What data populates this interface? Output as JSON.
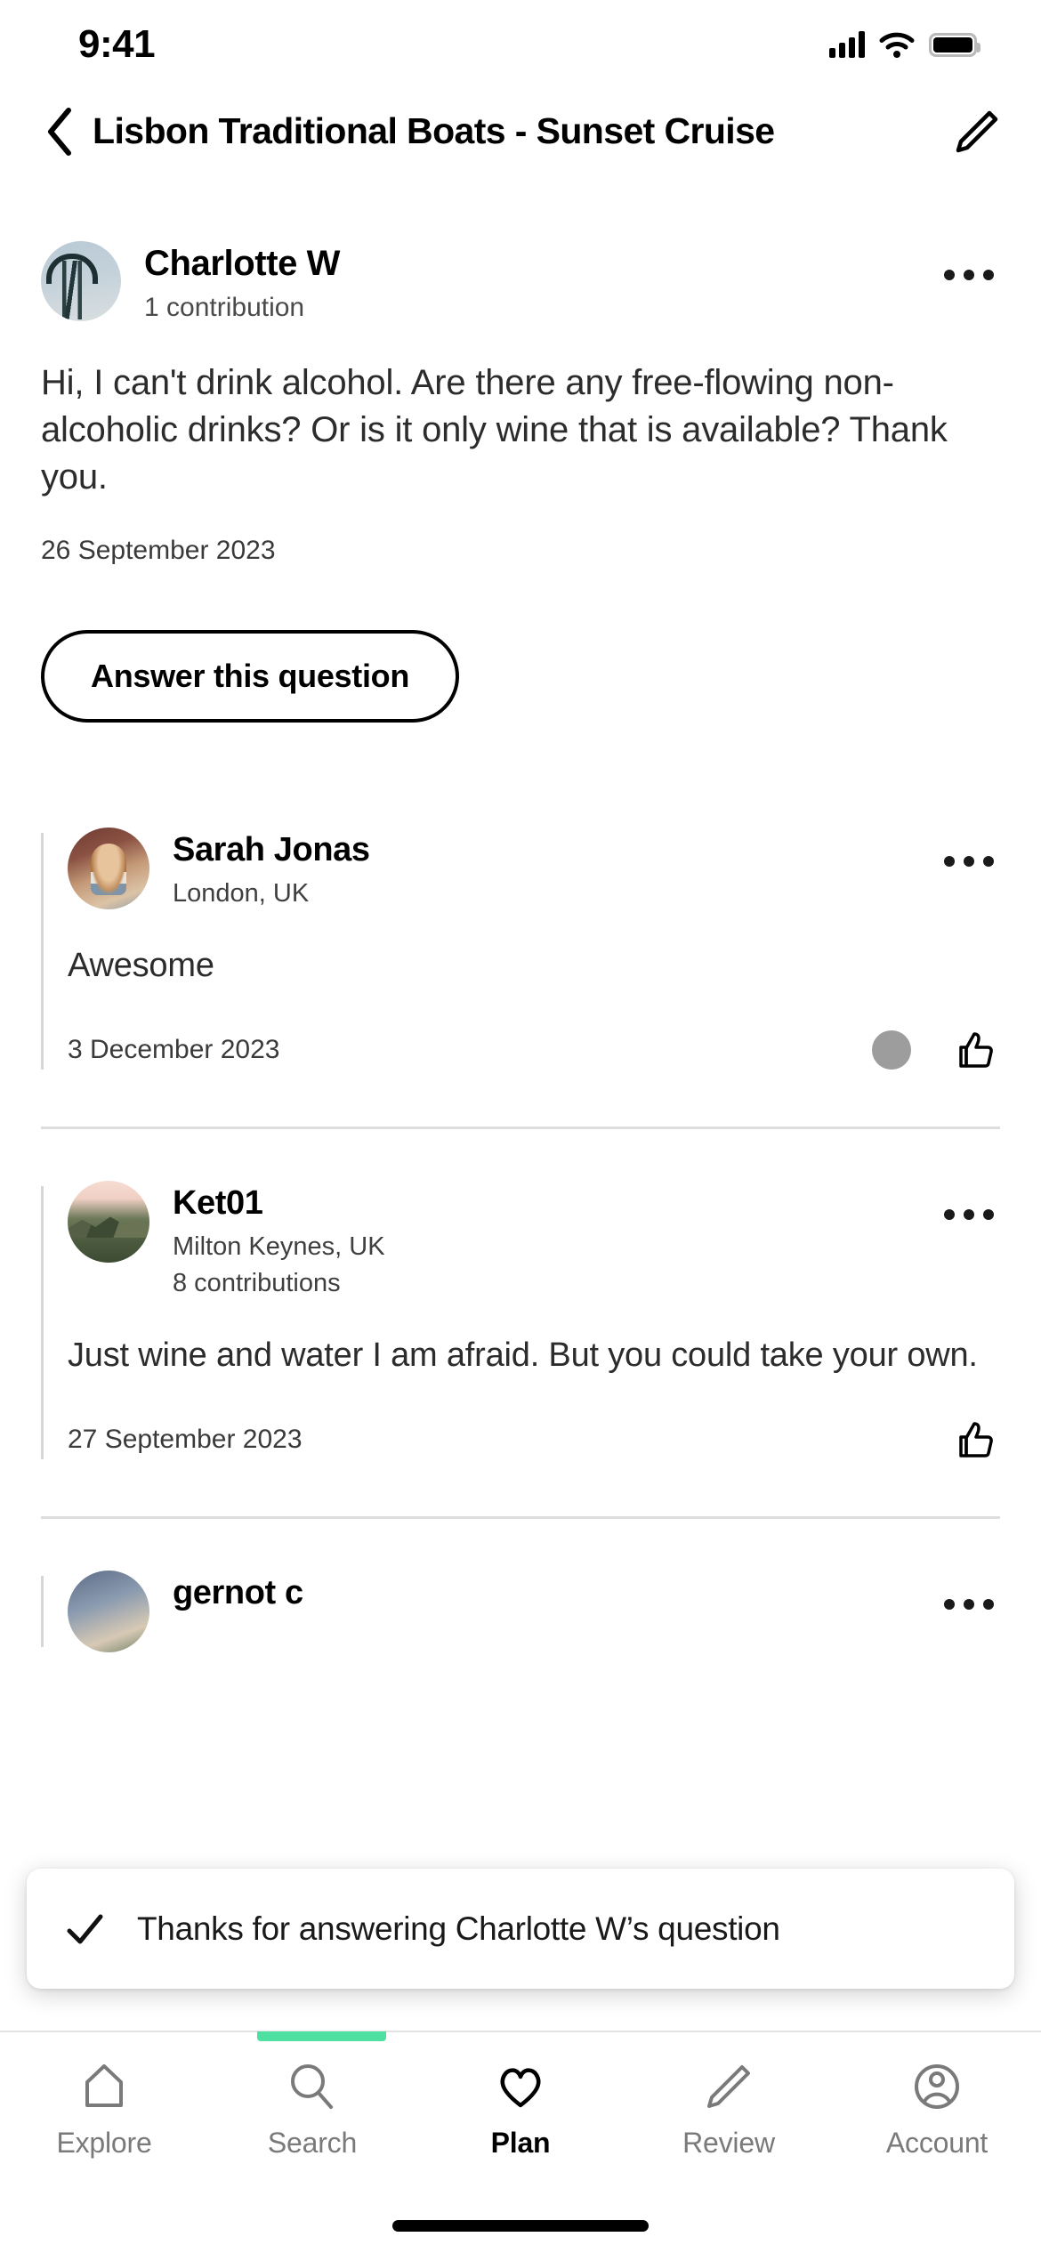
{
  "status_bar": {
    "time": "9:41",
    "signal_icon": "cellular-bars-icon",
    "wifi_icon": "wifi-icon",
    "battery_icon": "battery-full-icon"
  },
  "header": {
    "back_icon": "chevron-left-icon",
    "title": "Lisbon Traditional Boats - Sunset Cruise",
    "edit_icon": "pencil-icon"
  },
  "question": {
    "author": "Charlotte W",
    "contributions": "1 contribution",
    "avatar_icon": "roller-coaster-avatar",
    "more_icon": "more-options-icon",
    "text": "Hi, I can't drink alcohol. Are there any free-flowing non-alcoholic drinks? Or is it only wine that is available? Thank you.",
    "date": "26 September 2023",
    "answer_button": "Answer this question"
  },
  "replies": [
    {
      "author": "Sarah Jonas",
      "location": "London, UK",
      "contributions": "",
      "avatar_icon": "sarah-avatar",
      "more_icon": "more-options-icon",
      "text": "Awesome",
      "date": "3 December 2023",
      "like_icon": "thumbs-up-icon",
      "has_grey_dot": true
    },
    {
      "author": "Ket01",
      "location": "Milton Keynes, UK",
      "contributions": "8 contributions",
      "avatar_icon": "ket01-avatar",
      "more_icon": "more-options-icon",
      "text": "Just wine and water I am afraid. But you could take your own.",
      "date": "27 September 2023",
      "like_icon": "thumbs-up-icon",
      "has_grey_dot": false
    },
    {
      "author": "gernot c",
      "location": "",
      "contributions": "",
      "avatar_icon": "gernot-avatar",
      "more_icon": "more-options-icon",
      "text": "",
      "date": "",
      "like_icon": "thumbs-up-icon",
      "has_grey_dot": false
    }
  ],
  "toast": {
    "check_icon": "check-icon",
    "message": "Thanks for answering Charlotte W’s question"
  },
  "tabbar": {
    "active_indicator_color": "#4de0a0",
    "items": [
      {
        "label": "Explore",
        "icon": "home-icon",
        "active": false
      },
      {
        "label": "Search",
        "icon": "search-icon",
        "active": false
      },
      {
        "label": "Plan",
        "icon": "heart-icon",
        "active": true
      },
      {
        "label": "Review",
        "icon": "pencil-icon",
        "active": false
      },
      {
        "label": "Account",
        "icon": "account-circle-icon",
        "active": false
      }
    ]
  }
}
